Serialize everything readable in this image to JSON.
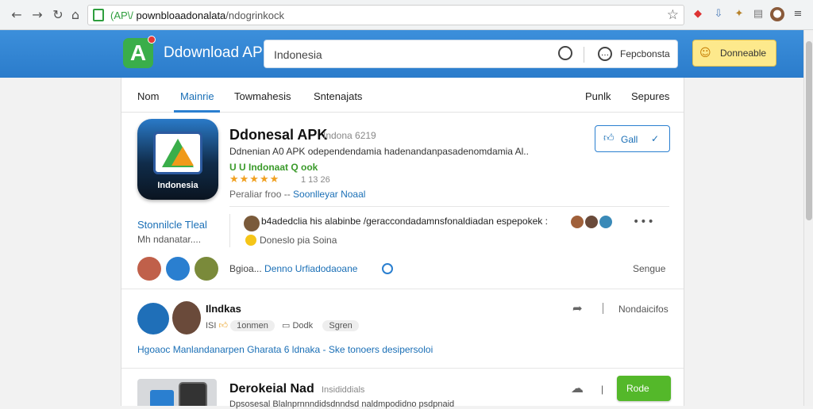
{
  "browser": {
    "url_scheme": "(AP\\/",
    "url_host": " pownbloaadonalata",
    "url_path": "/ndogrinkock"
  },
  "header": {
    "brand": "Ddownload APK",
    "search_value": "Indonesia",
    "search_side_label": "Fepcbonsta",
    "donate_label": "Donneable"
  },
  "tabs": [
    "Nom",
    "Mainrie",
    "Towmahesis",
    "Sntenajats",
    "Punlk",
    "Sepures"
  ],
  "app": {
    "icon_caption": "Indonesia",
    "title": "Ddonesal APK",
    "version": "Indona 6219",
    "description": "Ddnenian A0 APK   odependendamia hadenandanpasadenomdamia  Al..",
    "tags": "U U Indonaat  Q ook",
    "stars": "★★★★★",
    "rating": "1 13 26",
    "author_prefix": "Peraliar  froo  -- ",
    "author_link": "Soonlleyar Noaal",
    "get_label": "Gall",
    "get_check": "✓"
  },
  "sidebar": {
    "link": "Stonnilcle Tleal",
    "sub": "Mh ndanatar...."
  },
  "comment": {
    "text": "b4adedclia his alabinbe /geraccondadamnsfonaldiadan  espepokek :",
    "sub": "Doneslo pia Soina",
    "more": "•••"
  },
  "row": {
    "prefix": "Bgioa... ",
    "link": "Denno Urfiadodaoane",
    "right": "Sengue"
  },
  "post": {
    "name": "Ilndkas",
    "meta_prefix": "ISI",
    "meta_mid": "1onmen",
    "meta_pill_1": "Dodk",
    "meta_pill_2": "Sgren",
    "right": "Nondaicifos",
    "description": "Hgoaoc  Manlandanarpen Gharata 6 ldnaka - Ske  tonoers desipersoloi"
  },
  "post2": {
    "title": "Derokeial Nad",
    "subtitle": "Insididdials",
    "description": "Dpsosesal Blalnprnnndidsdnndsd naldmpodidno psdpnaid",
    "button": "Rode"
  },
  "colors": {
    "header_blue": "#2b7ccb",
    "accent_link": "#1a6fb6",
    "green": "#54b82a",
    "donate_yellow": "#fde98c"
  }
}
